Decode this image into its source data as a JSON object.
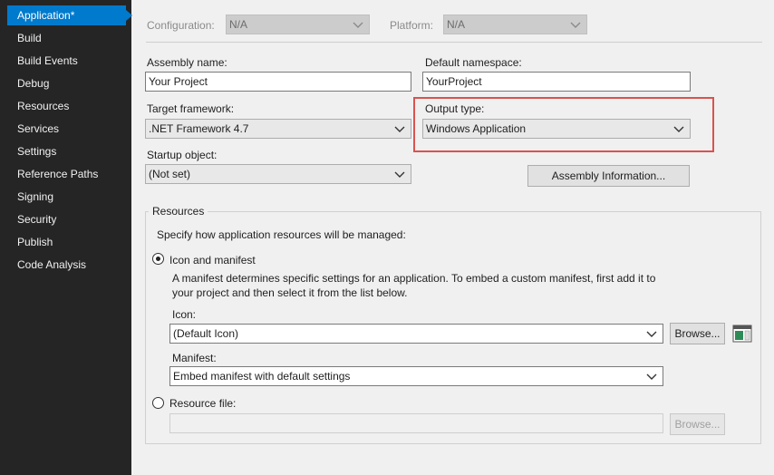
{
  "sidebar": {
    "items": [
      {
        "label": "Application*",
        "active": true
      },
      {
        "label": "Build"
      },
      {
        "label": "Build Events"
      },
      {
        "label": "Debug"
      },
      {
        "label": "Resources"
      },
      {
        "label": "Services"
      },
      {
        "label": "Settings"
      },
      {
        "label": "Reference Paths"
      },
      {
        "label": "Signing"
      },
      {
        "label": "Security"
      },
      {
        "label": "Publish"
      },
      {
        "label": "Code Analysis"
      }
    ]
  },
  "toolbar": {
    "configuration_label": "Configuration:",
    "configuration_value": "N/A",
    "platform_label": "Platform:",
    "platform_value": "N/A"
  },
  "form": {
    "assembly_name_label": "Assembly name:",
    "assembly_name_value": "Your Project",
    "default_namespace_label": "Default namespace:",
    "default_namespace_value": "YourProject",
    "target_framework_label": "Target framework:",
    "target_framework_value": ".NET Framework 4.7",
    "output_type_label": "Output type:",
    "output_type_value": "Windows Application",
    "startup_object_label": "Startup object:",
    "startup_object_value": "(Not set)",
    "assembly_info_button": "Assembly Information..."
  },
  "resources": {
    "group_title": "Resources",
    "description": "Specify how application resources will be managed:",
    "icon_manifest_option": "Icon and manifest",
    "icon_manifest_selected": true,
    "icon_manifest_help_line1": "A manifest determines specific settings for an application. To embed a custom manifest, first add it to",
    "icon_manifest_help_line2": "your project and then select it from the list below.",
    "icon_label": "Icon:",
    "icon_value": "(Default Icon)",
    "browse_button": "Browse...",
    "manifest_label": "Manifest:",
    "manifest_value": "Embed manifest with default settings",
    "resource_file_option": "Resource file:",
    "resource_file_selected": false,
    "resource_file_value": "",
    "resource_browse_button": "Browse..."
  },
  "colors": {
    "sidebar_bg": "#252526",
    "active_item": "#007acc",
    "highlight_border": "#d9534f"
  }
}
